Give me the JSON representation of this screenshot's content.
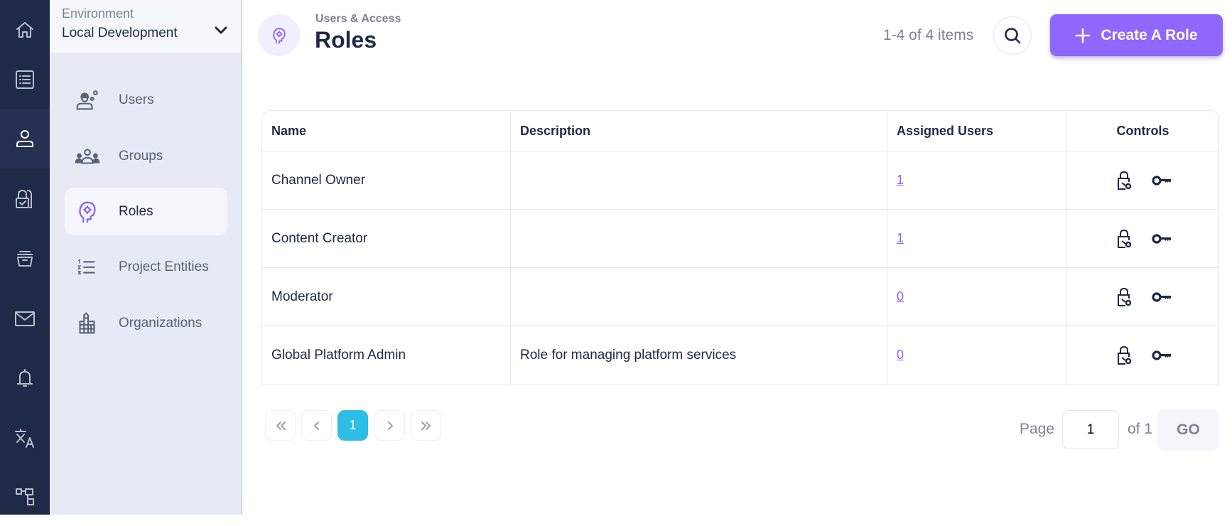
{
  "rail": {
    "items": [
      {
        "icon": "home-icon",
        "active": false
      },
      {
        "icon": "list-icon",
        "active": false
      },
      {
        "icon": "user-icon",
        "active": true
      },
      {
        "icon": "lock-check-icon",
        "active": false
      },
      {
        "icon": "archive-icon",
        "active": false
      },
      {
        "icon": "mail-icon",
        "active": false
      },
      {
        "icon": "bell-icon",
        "active": false
      },
      {
        "icon": "translate-icon",
        "active": false
      },
      {
        "icon": "hierarchy-icon",
        "active": false
      }
    ]
  },
  "environment": {
    "label": "Environment",
    "value": "Local Development"
  },
  "sidebar": {
    "items": [
      {
        "label": "Users",
        "icon": "user-gear-icon",
        "active": false
      },
      {
        "label": "Groups",
        "icon": "group-icon",
        "active": false
      },
      {
        "label": "Roles",
        "icon": "head-gear-icon",
        "active": true
      },
      {
        "label": "Project Entities",
        "icon": "numbered-list-icon",
        "active": false
      },
      {
        "label": "Organizations",
        "icon": "building-icon",
        "active": false
      }
    ]
  },
  "header": {
    "breadcrumb": "Users & Access",
    "title": "Roles",
    "count": "1-4 of 4 items",
    "create_label": "Create A Role"
  },
  "colors": {
    "accent": "#8f67fb",
    "rail_bg": "#1f2a48",
    "pagination_active": "#2ebde6"
  },
  "table": {
    "columns": [
      "Name",
      "Description",
      "Assigned Users",
      "Controls"
    ],
    "rows": [
      {
        "name": "Channel Owner",
        "description": "",
        "assigned_users": "1"
      },
      {
        "name": "Content Creator",
        "description": "",
        "assigned_users": "1"
      },
      {
        "name": "Moderator",
        "description": "",
        "assigned_users": "0"
      },
      {
        "name": "Global Platform Admin",
        "description": "Role for managing platform services",
        "assigned_users": "0"
      }
    ]
  },
  "pagination": {
    "current": "1",
    "page_label": "Page",
    "page_input": "1",
    "of_label": "of 1",
    "go_label": "GO"
  }
}
